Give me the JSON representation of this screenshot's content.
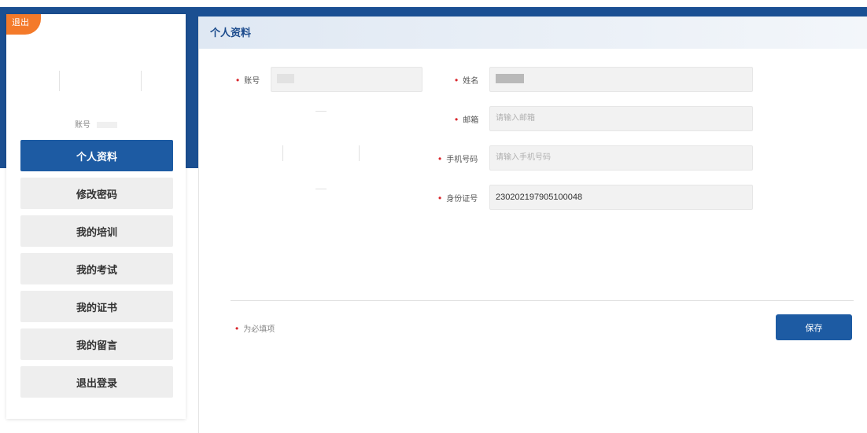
{
  "sidebar": {
    "exit_tag": "退出",
    "account_label": "账号",
    "menu": [
      {
        "label": "个人资料"
      },
      {
        "label": "修改密码"
      },
      {
        "label": "我的培训"
      },
      {
        "label": "我的考试"
      },
      {
        "label": "我的证书"
      },
      {
        "label": "我的留言"
      },
      {
        "label": "退出登录"
      }
    ]
  },
  "main": {
    "title": "个人资料",
    "form": {
      "account": {
        "label": "账号",
        "value": ""
      },
      "name": {
        "label": "姓名",
        "value": ""
      },
      "email": {
        "label": "邮箱",
        "placeholder": "请输入邮箱"
      },
      "phone": {
        "label": "手机号码",
        "placeholder": "请输入手机号码"
      },
      "id_number": {
        "label": "身份证号",
        "value": "230202197905100048"
      }
    },
    "required_note": "为必填项",
    "save_label": "保存"
  },
  "colors": {
    "primary": "#1d5ba3",
    "header_band": "#1a4f93",
    "exit_tag": "#f47a2a",
    "required": "#d9262c"
  }
}
